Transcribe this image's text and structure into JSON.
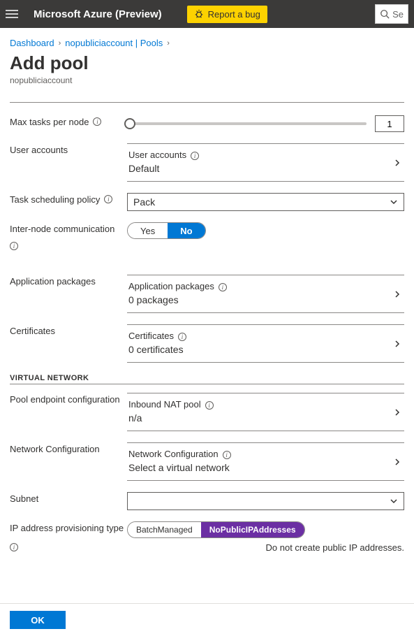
{
  "topbar": {
    "brand": "Microsoft Azure (Preview)",
    "report_bug": "Report a bug",
    "search_placeholder": "Se"
  },
  "breadcrumb": {
    "item0": "Dashboard",
    "item1": "nopubliciaccount | Pools"
  },
  "page": {
    "title": "Add pool",
    "subtitle": "nopubliciaccount"
  },
  "fields": {
    "max_tasks_label": "Max tasks per node",
    "max_tasks_value": "1",
    "user_accounts_label": "User accounts",
    "user_accounts_item_label": "User accounts",
    "user_accounts_item_value": "Default",
    "scheduling_label": "Task scheduling policy",
    "scheduling_value": "Pack",
    "internode_label": "Inter-node communication",
    "internode_yes": "Yes",
    "internode_no": "No",
    "app_pkg_label": "Application packages",
    "app_pkg_item_label": "Application packages",
    "app_pkg_item_value": "0 packages",
    "certs_label": "Certificates",
    "certs_item_label": "Certificates",
    "certs_item_value": "0 certificates",
    "vnet_section": "VIRTUAL NETWORK",
    "pool_endpoint_label": "Pool endpoint configuration",
    "pool_endpoint_item_label": "Inbound NAT pool",
    "pool_endpoint_item_value": "n/a",
    "netconf_label": "Network Configuration",
    "netconf_item_label": "Network Configuration",
    "netconf_item_value": "Select a virtual network",
    "subnet_label": "Subnet",
    "subnet_value": "",
    "ip_prov_label": "IP address provisioning type",
    "ip_prov_opt1": "BatchManaged",
    "ip_prov_opt2": "NoPublicIPAddresses",
    "ip_prov_help": "Do not create public IP addresses."
  },
  "footer": {
    "ok": "OK"
  }
}
